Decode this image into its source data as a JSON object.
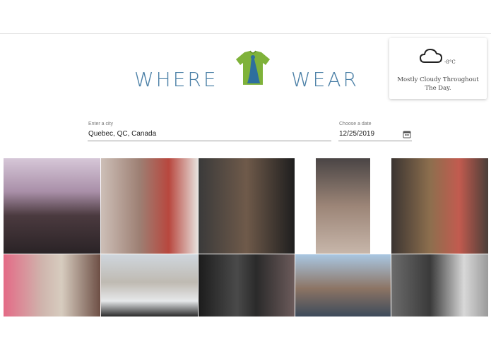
{
  "logo": {
    "left_text": "WHERE",
    "right_text": "WEAR"
  },
  "weather": {
    "icon": "cloud-icon",
    "temperature": "-8°C",
    "description": "Mostly Cloudy Throughout The Day."
  },
  "city": {
    "label": "Enter a city",
    "value": "Quebec, QC, Canada"
  },
  "date": {
    "label": "Choose a date",
    "value": "12/25/2019"
  },
  "colors": {
    "accent": "#4a7fa6",
    "shirt": "#7fb23a",
    "shirt_figure": "#2e6f9e"
  },
  "photos": [
    {
      "name": "photo-winter-market",
      "bg": "linear-gradient(180deg,#d6c7d8 0%,#a98fa8 35%,#4b3a3f 60%,#2a2326 100%)"
    },
    {
      "name": "photo-couple-plaid",
      "bg": "linear-gradient(90deg,#cdbfb7 0%,#9d7f73 40%,#b8473e 70%,#e6e0dc 100%)"
    },
    {
      "name": "photo-two-men",
      "bg": "linear-gradient(90deg,#3a3a3a 0%,#6f5a4a 50%,#1e1e1e 100%)"
    },
    {
      "name": "photo-group-restaurant",
      "bg": "linear-gradient(180deg,#4a4545 0%,#9c8577 50%,#c7b6aa 100%)"
    },
    {
      "name": "photo-couple-sweaters",
      "bg": "linear-gradient(90deg,#3b3431 0%,#8d6f4e 40%,#c25b4f 70%,#4a3e38 100%)"
    },
    {
      "name": "photo-hats-selfie",
      "bg": "linear-gradient(90deg,#e46a86 0%,#cfb5ad 40%,#d7ccbf 60%,#6d4f45 100%)"
    },
    {
      "name": "photo-snow-building",
      "bg": "linear-gradient(180deg,#cfd6dd 0%,#bfbab2 45%,#e6e8ea 75%,#2b2b2b 100%)"
    },
    {
      "name": "photo-dark-interior",
      "bg": "linear-gradient(90deg,#1c1c1c 0%,#4a4a4a 40%,#2a2a2a 60%,#6c5b5b 100%)"
    },
    {
      "name": "photo-window-selfie",
      "bg": "linear-gradient(180deg,#a9c7e2 0%,#8c7464 55%,#3d4b5b 100%)"
    },
    {
      "name": "photo-eiffel-bw",
      "bg": "linear-gradient(90deg,#6b6b6b 0%,#3a3a3a 40%,#d8d8d8 75%,#9a9a9a 100%)"
    }
  ]
}
